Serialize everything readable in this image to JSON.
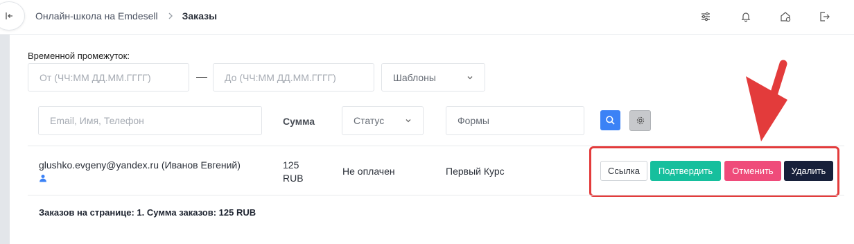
{
  "breadcrumb": {
    "school": "Онлайн-школа на Emdesell",
    "current": "Заказы"
  },
  "header_icons": [
    "sliders-icon",
    "bell-icon",
    "home-settings-icon",
    "logout-icon"
  ],
  "filters": {
    "range_label": "Временной промежуток:",
    "from_placeholder": "От (ЧЧ:ММ ДД.ММ.ГГГГ)",
    "to_placeholder": "До (ЧЧ:ММ ДД.ММ.ГГГГ)",
    "templates_label": "Шаблоны"
  },
  "table": {
    "search_placeholder": "Email, Имя, Телефон",
    "sum_header": "Сумма",
    "status_label": "Статус",
    "forms_placeholder": "Формы"
  },
  "order": {
    "customer": "glushko.evgeny@yandex.ru (Иванов Евгений)",
    "amount": "125",
    "currency": "RUB",
    "status": "Не оплачен",
    "form": "Первый Курс"
  },
  "actions": {
    "link": "Ссылка",
    "confirm": "Подтвердить",
    "cancel": "Отменить",
    "delete": "Удалить"
  },
  "footer_text": "Заказов на странице: 1. Сумма заказов: 125 RUB",
  "colors": {
    "accent_blue": "#3b82f6",
    "confirm": "#16bf9d",
    "cancel": "#ef4b7a",
    "delete": "#17203a",
    "annotation_red": "#e33b3b"
  }
}
